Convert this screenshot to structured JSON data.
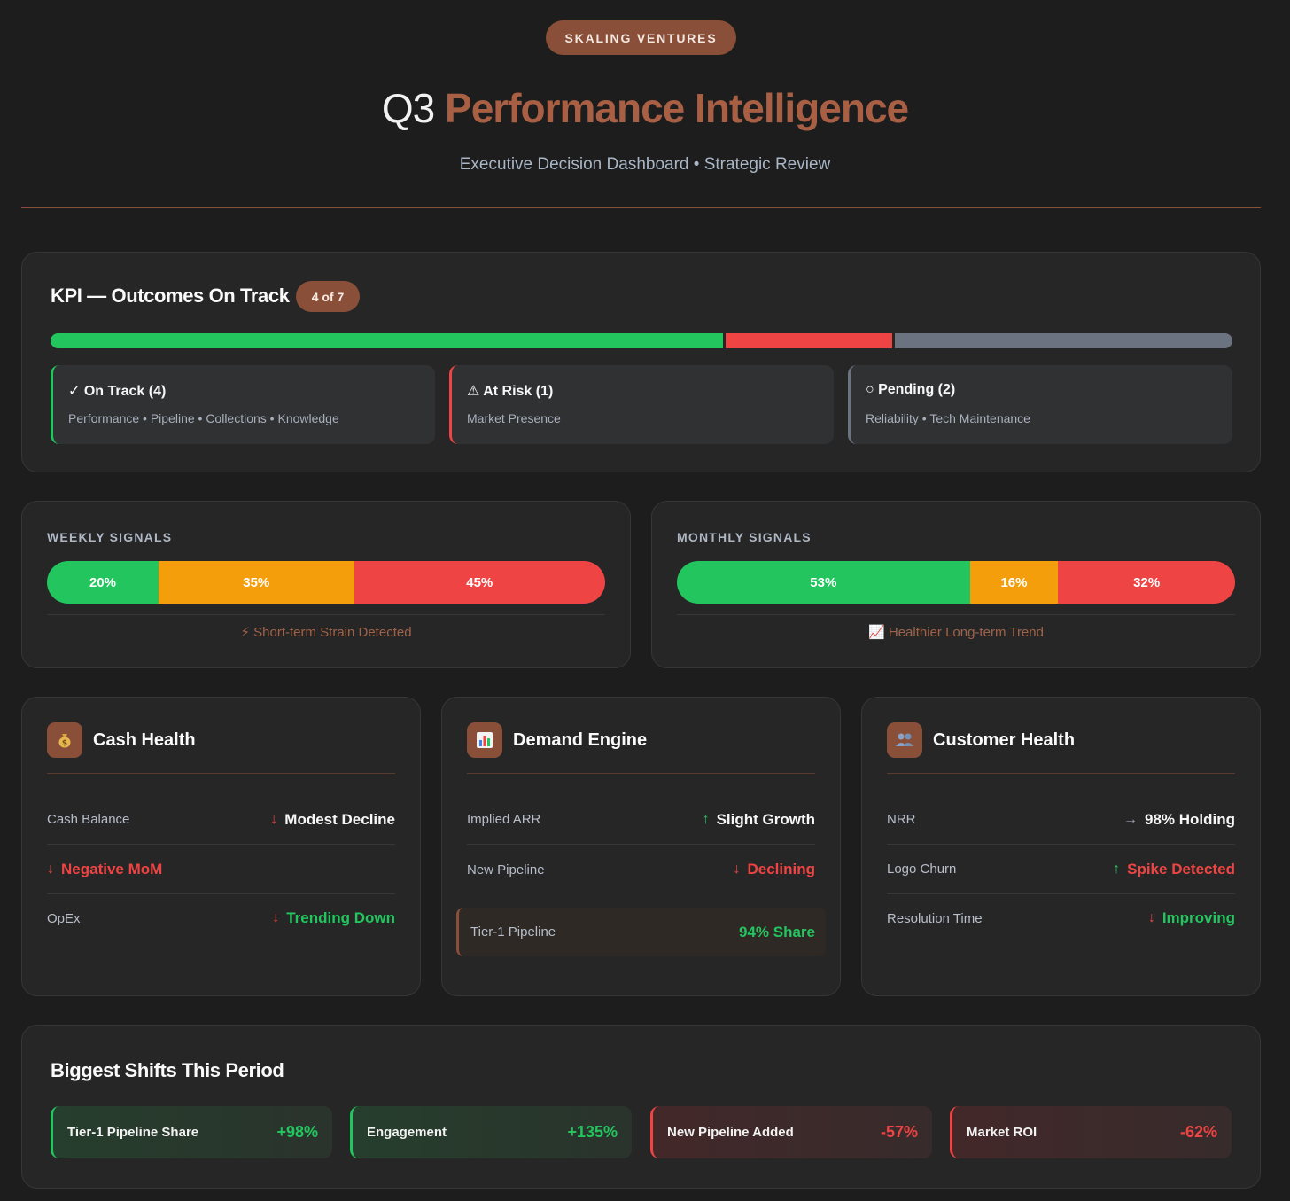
{
  "header": {
    "brand": "SKALING VENTURES",
    "title_prefix": "Q3",
    "title_accent": "Performance Intelligence",
    "subtitle": "Executive Decision Dashboard • Strategic Review"
  },
  "kpi": {
    "title": "KPI — Outcomes On Track",
    "badge": "4 of 7",
    "bar": [
      {
        "status": "on_track",
        "count": 4,
        "color": "#22c55e"
      },
      {
        "status": "at_risk",
        "count": 1,
        "color": "#ef4444"
      },
      {
        "status": "pending",
        "count": 2,
        "color": "#6b7280"
      }
    ],
    "groups": [
      {
        "title": "✓ On Track (4)",
        "items": "Performance • Pipeline • Collections • Knowledge",
        "color": "#22c55e"
      },
      {
        "title": "⚠ At Risk (1)",
        "items": "Market Presence",
        "color": "#ef4444"
      },
      {
        "title": "○ Pending (2)",
        "items": "Reliability • Tech Maintenance",
        "color": "#6b7280"
      }
    ]
  },
  "signals": {
    "weekly": {
      "label": "WEEKLY SIGNALS",
      "segments": [
        {
          "value": 20,
          "text": "20%",
          "color": "#22c55e"
        },
        {
          "value": 35,
          "text": "35%",
          "color": "#f59e0b"
        },
        {
          "value": 45,
          "text": "45%",
          "color": "#ef4444"
        }
      ],
      "note": "⚡ Short-term Strain Detected"
    },
    "monthly": {
      "label": "MONTHLY SIGNALS",
      "segments": [
        {
          "value": 53,
          "text": "53%",
          "color": "#22c55e"
        },
        {
          "value": 16,
          "text": "16%",
          "color": "#f59e0b"
        },
        {
          "value": 32,
          "text": "32%",
          "color": "#ef4444"
        }
      ],
      "note": "📈 Healthier Long-term Trend"
    }
  },
  "cash": {
    "title": "Cash Health",
    "icon": "money-bag-icon",
    "rows": [
      {
        "label": "Cash Balance",
        "arrow": "↓",
        "value": "Modest Decline"
      },
      {
        "label": "",
        "arrow": "↓",
        "value": "Negative MoM"
      },
      {
        "label": "OpEx",
        "arrow": "↓",
        "value": "Trending Down"
      }
    ]
  },
  "demand": {
    "title": "Demand Engine",
    "icon": "bar-chart-icon",
    "rows": [
      {
        "label": "Implied ARR",
        "arrow": "↑",
        "value": "Slight Growth"
      },
      {
        "label": "New Pipeline",
        "arrow": "↓",
        "value": "Declining"
      }
    ],
    "highlight": {
      "label": "Tier-1 Pipeline",
      "value": "94% Share"
    }
  },
  "customer": {
    "title": "Customer Health",
    "icon": "people-icon",
    "rows": [
      {
        "label": "NRR",
        "arrow": "→",
        "value": "98% Holding"
      },
      {
        "label": "Logo Churn",
        "arrow": "↑",
        "value": "Spike Detected"
      },
      {
        "label": "Resolution Time",
        "arrow": "↓",
        "value": "Improving"
      }
    ]
  },
  "shifts": {
    "title": "Biggest Shifts This Period",
    "items": [
      {
        "label": "Tier-1 Pipeline Share",
        "value": "+98%"
      },
      {
        "label": "Engagement",
        "value": "+135%"
      },
      {
        "label": "New Pipeline Added",
        "value": "-57%"
      },
      {
        "label": "Market ROI",
        "value": "-62%"
      }
    ]
  }
}
